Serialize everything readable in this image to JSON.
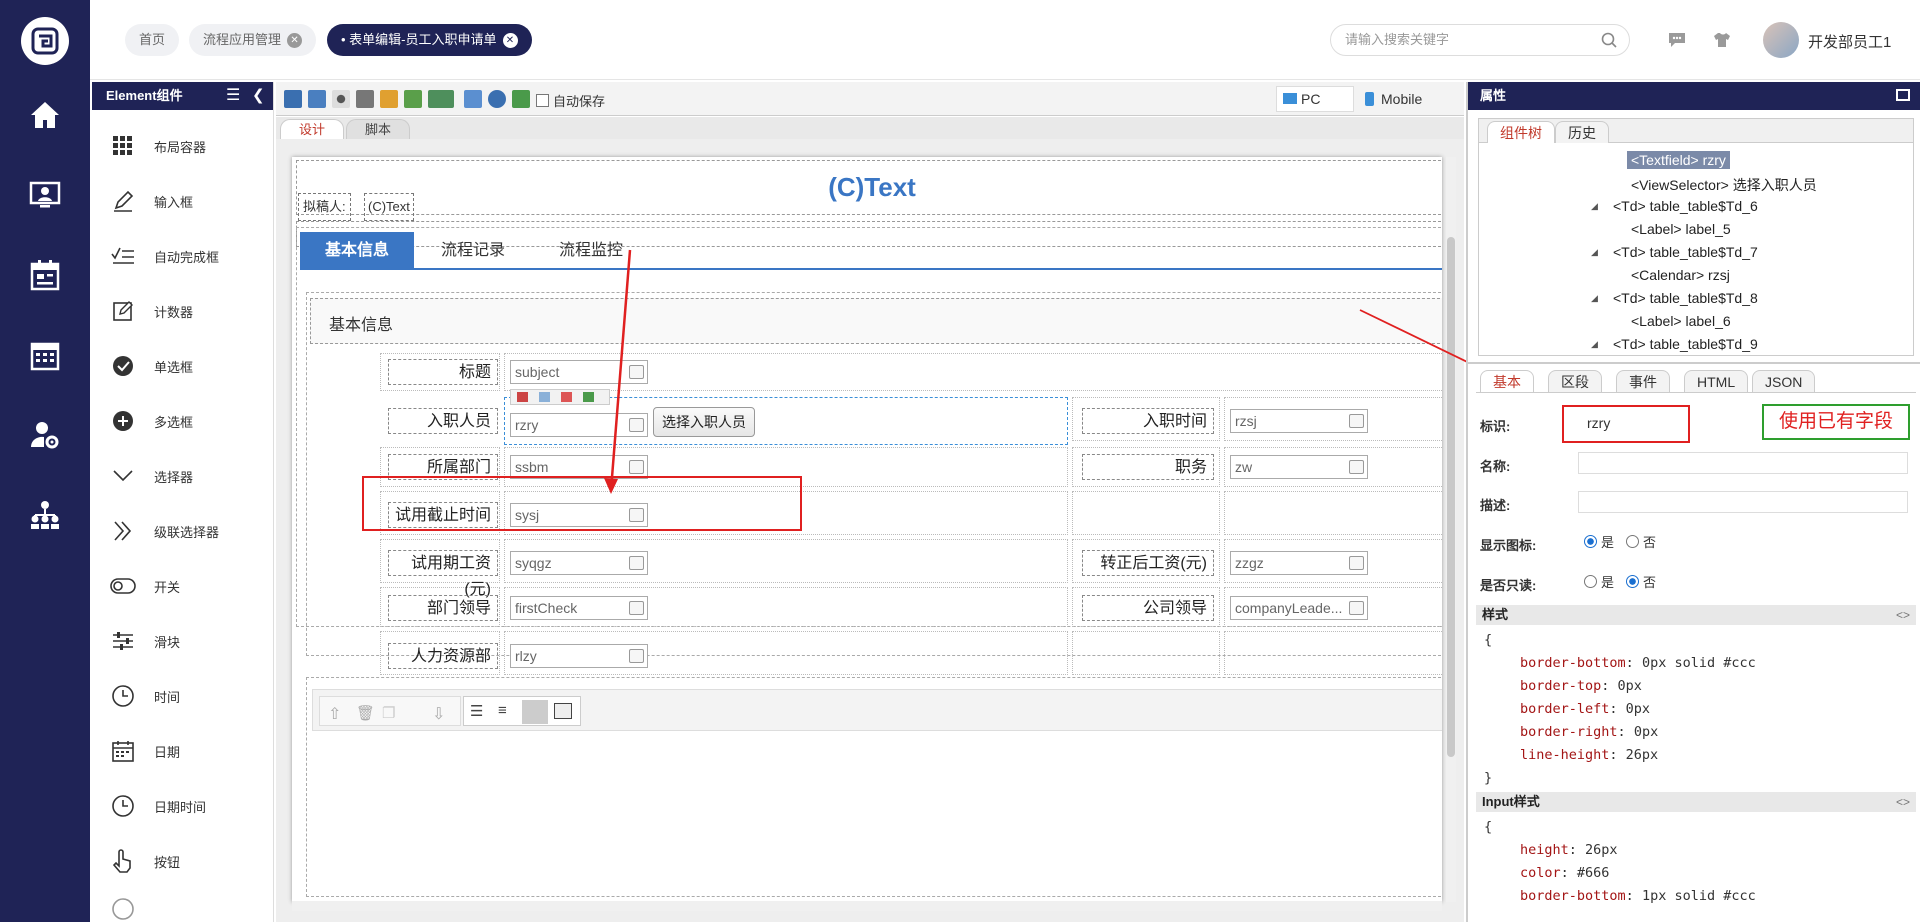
{
  "header": {
    "tabs": [
      {
        "label": "首页"
      },
      {
        "label": "流程应用管理"
      },
      {
        "label": "• 表单编辑-员工入职申请单"
      }
    ],
    "search_placeholder": "请输入搜索关键字",
    "user_name": "开发部员工1"
  },
  "components": {
    "title": "Element组件",
    "items": [
      {
        "label": "布局容器",
        "icon": "grid-icon"
      },
      {
        "label": "输入框",
        "icon": "pen-icon"
      },
      {
        "label": "自动完成框",
        "icon": "autocomplete-icon"
      },
      {
        "label": "计数器",
        "icon": "edit-box-icon"
      },
      {
        "label": "单选框",
        "icon": "radio-check-icon"
      },
      {
        "label": "多选框",
        "icon": "plus-circle-icon"
      },
      {
        "label": "选择器",
        "icon": "chevron-down-icon"
      },
      {
        "label": "级联选择器",
        "icon": "double-chevron-icon"
      },
      {
        "label": "开关",
        "icon": "toggle-icon"
      },
      {
        "label": "滑块",
        "icon": "slider-icon"
      },
      {
        "label": "时间",
        "icon": "clock-icon"
      },
      {
        "label": "日期",
        "icon": "calendar-icon"
      },
      {
        "label": "日期时间",
        "icon": "clock-icon"
      },
      {
        "label": "按钮",
        "icon": "hand-pointer-icon"
      }
    ]
  },
  "toolbar": {
    "autosave_label": "自动保存",
    "pc_label": "PC",
    "mobile_label": "Mobile"
  },
  "design_tabs": {
    "design": "设计",
    "script": "脚本"
  },
  "form": {
    "title": "(C)Text",
    "drafter_label": "拟稿人:",
    "drafter_value": "(C)Text",
    "tabs": [
      "基本信息",
      "流程记录",
      "流程监控"
    ],
    "section_title": "基本信息",
    "fields": {
      "subject_label": "标题",
      "subject_value": "subject",
      "rzry_label": "入职人员",
      "rzry_value": "rzry",
      "rzry_button": "选择入职人员",
      "rzsj_label": "入职时间",
      "rzsj_value": "rzsj",
      "ssbm_label": "所属部门",
      "ssbm_value": "ssbm",
      "zw_label": "职务",
      "zw_value": "zw",
      "sysj_label": "试用截止时间",
      "sysj_value": "sysj",
      "syqgz_label": "试用期工资(元)",
      "syqgz_value": "syqgz",
      "zzgz_label": "转正后工资(元)",
      "zzgz_value": "zzgz",
      "bmld_label": "部门领导",
      "bmld_value": "firstCheck",
      "gsld_label": "公司领导",
      "gsld_value": "companyLeade...",
      "rlzy_label": "人力资源部",
      "rlzy_value": "rlzy"
    }
  },
  "props": {
    "title": "属性",
    "tree_tabs": [
      "组件树",
      "历史"
    ],
    "tree_nodes": [
      {
        "label": "<Textfield> rzry",
        "selected": true
      },
      {
        "label": "<ViewSelector> 选择入职人员"
      },
      {
        "label": "<Td> table_table$Td_6"
      },
      {
        "label": "<Label> label_5"
      },
      {
        "label": "<Td> table_table$Td_7"
      },
      {
        "label": "<Calendar> rzsj"
      },
      {
        "label": "<Td> table_table$Td_8"
      },
      {
        "label": "<Label> label_6"
      },
      {
        "label": "<Td> table_table$Td_9"
      }
    ],
    "prop_tabs": [
      "基本",
      "区段",
      "事件",
      "HTML",
      "JSON"
    ],
    "id_label": "标识:",
    "id_value": "rzry",
    "annotation": "使用已有字段",
    "name_label": "名称:",
    "desc_label": "描述:",
    "show_icon_label": "显示图标:",
    "readonly_label": "是否只读:",
    "yes": "是",
    "no": "否",
    "style_title": "样式",
    "style_lines": [
      {
        "k": "border-bottom",
        "v": "0px solid #ccc"
      },
      {
        "k": "border-top",
        "v": "0px"
      },
      {
        "k": "border-left",
        "v": "0px"
      },
      {
        "k": "border-right",
        "v": "0px"
      },
      {
        "k": "line-height",
        "v": "26px"
      }
    ],
    "input_style_title": "Input样式",
    "input_style_lines": [
      {
        "k": "height",
        "v": "26px"
      },
      {
        "k": "color",
        "v": "#666"
      },
      {
        "k": "border-bottom",
        "v": "1px solid #ccc"
      }
    ],
    "open_brace": "{",
    "close_brace": "}"
  },
  "colors": {
    "navy": "#1f2356",
    "accent_blue": "#3a76c4",
    "annotation_red": "#e02020",
    "annotation_green": "#2e9e2e"
  }
}
